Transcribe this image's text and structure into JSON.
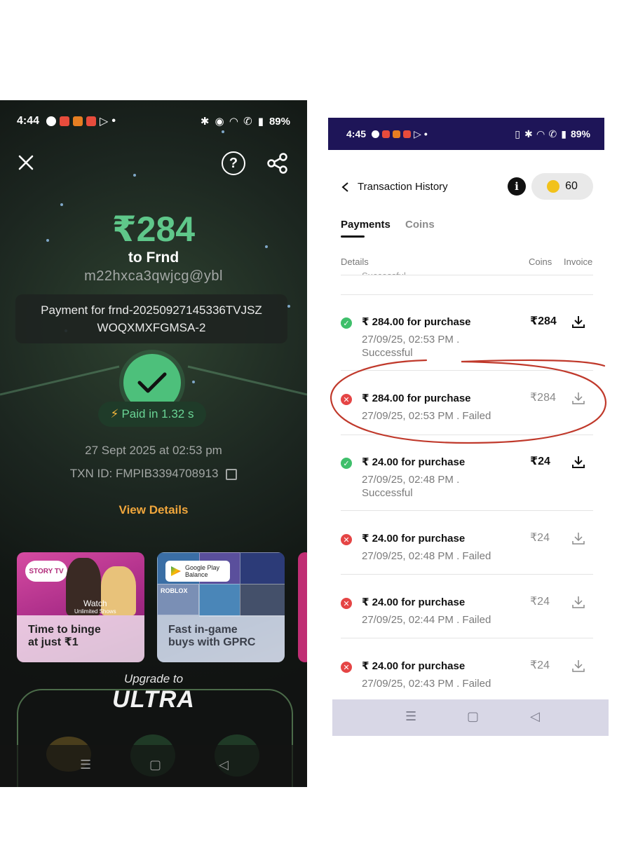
{
  "left": {
    "status_time": "4:44",
    "battery": "89%",
    "amount": "₹284",
    "to": "to Frnd",
    "upi_id": "m22hxca3qwjcg@ybl",
    "note_line1": "Payment for frnd-20250927145336TVJSZ",
    "note_line2": "WOQXMXFGMSA-2",
    "paid_in": "Paid in 1.32 s",
    "date": "27 Sept 2025 at 02:53 pm",
    "txn_id": "TXN ID: FMPIB3394708913",
    "view_details": "View Details",
    "promo1": {
      "badge": "STORY TV",
      "watch": "Watch",
      "watch_sub": "Unlimited Shows",
      "line1": "Time to binge",
      "line2": "at just ₹1"
    },
    "promo2": {
      "badge_line1": "Google Play",
      "badge_line2": "Balance",
      "tile_label": "ROBLOX",
      "line1": "Fast in-game",
      "line2": "buys with GPRC"
    },
    "upgrade": "Upgrade to",
    "ultra": "ULTRA",
    "accent_green": "#5fc78a",
    "accent_orange": "#f0a63c"
  },
  "right": {
    "status_time": "4:45",
    "battery": "89%",
    "title": "Transaction History",
    "coins": "60",
    "tabs": [
      "Payments",
      "Coins"
    ],
    "columns": {
      "details": "Details",
      "coins": "Coins",
      "invoice": "Invoice"
    },
    "peek_text": "Successful",
    "rows": [
      {
        "status": "success",
        "title": "₹ 284.00 for purchase",
        "sub": "27/09/25, 02:53 PM . Successful",
        "amount": "₹284"
      },
      {
        "status": "failed",
        "title": "₹ 284.00 for purchase",
        "sub": "27/09/25, 02:53 PM . Failed",
        "amount": "₹284"
      },
      {
        "status": "success",
        "title": "₹ 24.00 for purchase",
        "sub": "27/09/25, 02:48 PM . Successful",
        "amount": "₹24"
      },
      {
        "status": "failed",
        "title": "₹ 24.00 for purchase",
        "sub": "27/09/25, 02:48 PM . Failed",
        "amount": "₹24"
      },
      {
        "status": "failed",
        "title": "₹ 24.00 for purchase",
        "sub": "27/09/25, 02:44 PM . Failed",
        "amount": "₹24"
      },
      {
        "status": "failed",
        "title": "₹ 24.00 for purchase",
        "sub": "27/09/25, 02:43 PM . Failed",
        "amount": "₹24"
      }
    ],
    "header_color": "#1e1558",
    "success_color": "#3fbf6b",
    "failed_color": "#e54545",
    "annotation_color": "#c0392b"
  }
}
